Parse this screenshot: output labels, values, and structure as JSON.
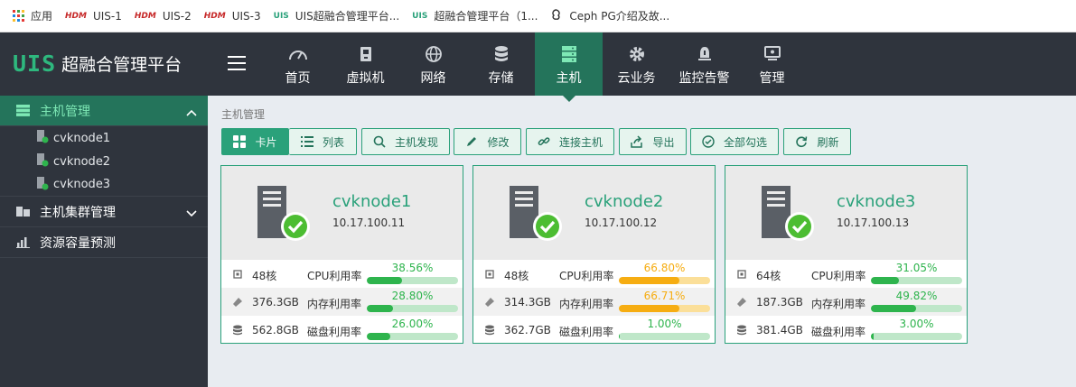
{
  "bookmarks": [
    {
      "icon": "apps-icon",
      "label": "应用"
    },
    {
      "icon": "hdm-icon",
      "label": "UIS-1"
    },
    {
      "icon": "hdm-icon",
      "label": "UIS-2"
    },
    {
      "icon": "hdm-icon",
      "label": "UIS-3"
    },
    {
      "icon": "uis-icon",
      "label": "UIS超融合管理平台..."
    },
    {
      "icon": "uis-icon",
      "label": "超融合管理平台（1..."
    },
    {
      "icon": "ceph-icon",
      "label": "Ceph PG介绍及故..."
    }
  ],
  "bookmark_icon_text": {
    "hdm": "HDM",
    "uis": "UIS"
  },
  "app": {
    "logo_mark": "UIS",
    "logo_name": "超融合管理平台"
  },
  "nav": [
    {
      "icon": "dashboard-icon",
      "label": "首页"
    },
    {
      "icon": "vm-icon",
      "label": "虚拟机"
    },
    {
      "icon": "globe-icon",
      "label": "网络"
    },
    {
      "icon": "database-icon",
      "label": "存储"
    },
    {
      "icon": "server-icon",
      "label": "主机",
      "active": true
    },
    {
      "icon": "gear-icon",
      "label": "云业务"
    },
    {
      "icon": "alarm-icon",
      "label": "监控告警"
    },
    {
      "icon": "monitor-icon",
      "label": "管理"
    }
  ],
  "sidebar": {
    "host_mgmt": "主机管理",
    "hosts": [
      "cvknode1",
      "cvknode2",
      "cvknode3"
    ],
    "cluster_mgmt": "主机集群管理",
    "capacity_forecast": "资源容量预测"
  },
  "breadcrumb": "主机管理",
  "toolbar": {
    "card": "卡片",
    "list": "列表",
    "discover": "主机发现",
    "edit": "修改",
    "connect": "连接主机",
    "export": "导出",
    "select_all": "全部勾选",
    "refresh": "刷新"
  },
  "hosts": [
    {
      "name": "cvknode1",
      "ip": "10.17.100.11",
      "cpu": "48核",
      "cpu_label": "CPU利用率",
      "cpu_pct": "38.56%",
      "cpu_val": 38.56,
      "mem": "376.3GB",
      "mem_label": "内存利用率",
      "mem_pct": "28.80%",
      "mem_val": 28.8,
      "disk": "562.8GB",
      "disk_label": "磁盘利用率",
      "disk_pct": "26.00%",
      "disk_val": 26.0,
      "status": "online"
    },
    {
      "name": "cvknode2",
      "ip": "10.17.100.12",
      "cpu": "48核",
      "cpu_label": "CPU利用率",
      "cpu_pct": "66.80%",
      "cpu_val": 66.8,
      "mem": "314.3GB",
      "mem_label": "内存利用率",
      "mem_pct": "66.71%",
      "mem_val": 66.71,
      "disk": "362.7GB",
      "disk_label": "磁盘利用率",
      "disk_pct": "1.00%",
      "disk_val": 1.0,
      "status": "online"
    },
    {
      "name": "cvknode3",
      "ip": "10.17.100.13",
      "cpu": "64核",
      "cpu_label": "CPU利用率",
      "cpu_pct": "31.05%",
      "cpu_val": 31.05,
      "mem": "187.3GB",
      "mem_label": "内存利用率",
      "mem_pct": "49.82%",
      "mem_val": 49.82,
      "disk": "381.4GB",
      "disk_label": "磁盘利用率",
      "disk_pct": "3.00%",
      "disk_val": 3.0,
      "status": "online"
    }
  ],
  "colors": {
    "accent": "#2aa17a",
    "active_nav": "#24745b",
    "ok_bar": "#2eb44d",
    "warn_bar": "#f6ad12",
    "topbar": "#2f343d"
  }
}
